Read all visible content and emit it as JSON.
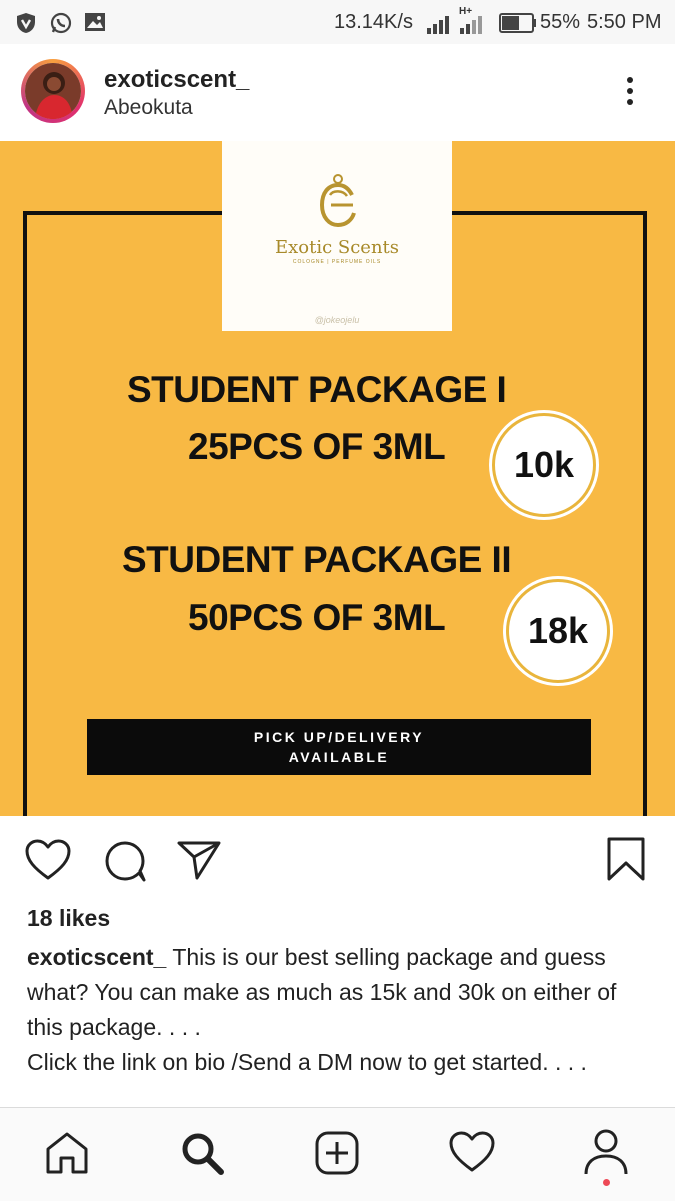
{
  "status_bar": {
    "network_speed": "13.14K/s",
    "network_type": "H+",
    "battery": "55%",
    "time": "5:50 PM",
    "icons": [
      "vpn-shield-icon",
      "whatsapp-icon",
      "gallery-icon",
      "signal-icon",
      "signal-icon",
      "battery-icon"
    ]
  },
  "post": {
    "username": "exoticscent_",
    "location": "Abeokuta",
    "image": {
      "logo_name": "Exotic Scents",
      "logo_tagline": "COLOGNE | PERFUME OILS",
      "logo_handle": "@jokeojelu",
      "package_1_title": "STUDENT PACKAGE I",
      "package_1_detail": "25PCS OF 3ML",
      "package_1_price": "10k",
      "package_2_title": "STUDENT PACKAGE II",
      "package_2_detail": "50PCS OF 3ML",
      "package_2_price": "18k",
      "cta_line_1": "PICK UP/DELIVERY",
      "cta_line_2": "AVAILABLE"
    },
    "likes": "18 likes",
    "caption_user": "exoticscent_",
    "caption_text": " This is our best selling package and guess what? You can make as much as 15k and 30k on either of this package. . . . ",
    "caption_text_2": "Click the link on bio /Send a DM now to get started. . . ."
  },
  "colors": {
    "post_bg": "#f8b944",
    "ink": "#111111",
    "gold": "#a88a2a",
    "notification": "#ed4956"
  },
  "bottom_nav": [
    "home-icon",
    "search-icon",
    "add-post-icon",
    "activity-heart-icon",
    "profile-icon"
  ]
}
